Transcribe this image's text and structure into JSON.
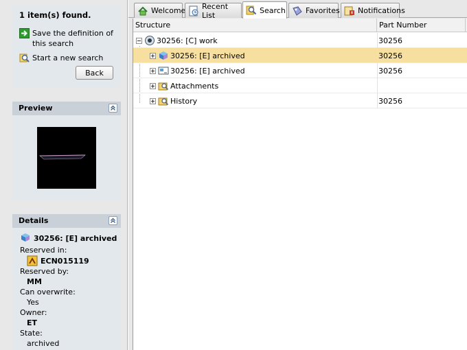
{
  "search_panel": {
    "found_text": "1 item(s) found.",
    "save_definition_link": "Save the definition of this search",
    "new_search_link": "Start a new search",
    "back_button": "Back"
  },
  "preview": {
    "title": "Preview"
  },
  "details": {
    "title": "Details",
    "item_name": "30256: [E] archived",
    "reserved_in_label": "Reserved in:",
    "reserved_in_value": "ECN015119",
    "reserved_by_label": "Reserved by:",
    "reserved_by_value": "MM",
    "can_overwrite_label": "Can overwrite:",
    "can_overwrite_value": "Yes",
    "owner_label": "Owner:",
    "owner_value": "ET",
    "state_label": "State:",
    "state_value": "archived"
  },
  "tabs": [
    {
      "label": "Welcome",
      "icon": "welcome-icon"
    },
    {
      "label": "Recent List",
      "icon": "recent-list-icon"
    },
    {
      "label": "Search",
      "icon": "search-icon",
      "active": true
    },
    {
      "label": "Favorites",
      "icon": "favorites-icon"
    },
    {
      "label": "Notifications",
      "icon": "notifications-icon"
    }
  ],
  "table": {
    "columns": [
      "Structure",
      "Part Number"
    ],
    "rows": [
      {
        "label": "30256: [C] work",
        "part_number": "30256",
        "icon": "work-node-icon",
        "expanded": true,
        "level": 0
      },
      {
        "label": "30256: [E] archived",
        "part_number": "30256",
        "icon": "part-icon",
        "selected": true,
        "level": 1
      },
      {
        "label": "30256: [E] archived",
        "part_number": "30256",
        "icon": "drawing-icon",
        "level": 1
      },
      {
        "label": "Attachments",
        "part_number": "",
        "icon": "folder-search-icon",
        "level": 1
      },
      {
        "label": "History",
        "part_number": "30256",
        "icon": "folder-search-icon",
        "level": 1
      }
    ]
  },
  "colors": {
    "selection": "#f7dfa0",
    "panel_bg": "#e3e8ec",
    "header_bg": "#c9d0d7"
  }
}
